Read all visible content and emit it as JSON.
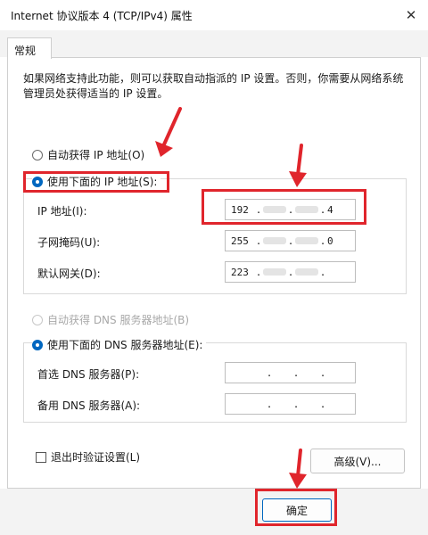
{
  "window": {
    "title": "Internet 协议版本 4 (TCP/IPv4) 属性"
  },
  "tabs": [
    {
      "label": "常规"
    }
  ],
  "description": "如果网络支持此功能，则可以获取自动指派的 IP 设置。否则，你需要从网络系统管理员处获得适当的 IP 设置。",
  "ip_section": {
    "auto_label": "自动获得 IP 地址(O)",
    "manual_label": "使用下面的 IP 地址(S):",
    "selected": "manual",
    "fields": [
      {
        "label": "IP 地址(I):",
        "octet1": "192",
        "octet4": "4"
      },
      {
        "label": "子网掩码(U):",
        "octet1": "255",
        "octet4": "0"
      },
      {
        "label": "默认网关(D):",
        "octet1": "223",
        "octet4": ""
      }
    ]
  },
  "dns_section": {
    "auto_label": "自动获得 DNS 服务器地址(B)",
    "manual_label": "使用下面的 DNS 服务器地址(E):",
    "selected": "manual",
    "preferred_label": "首选 DNS 服务器(P):",
    "alternate_label": "备用 DNS 服务器(A):"
  },
  "validate_label": "退出时验证设置(L)",
  "advanced_button": "高级(V)...",
  "ok_button": "确定",
  "ip_dot": ".",
  "annotation_color": "#e0252c",
  "accent_color": "#0067c0"
}
